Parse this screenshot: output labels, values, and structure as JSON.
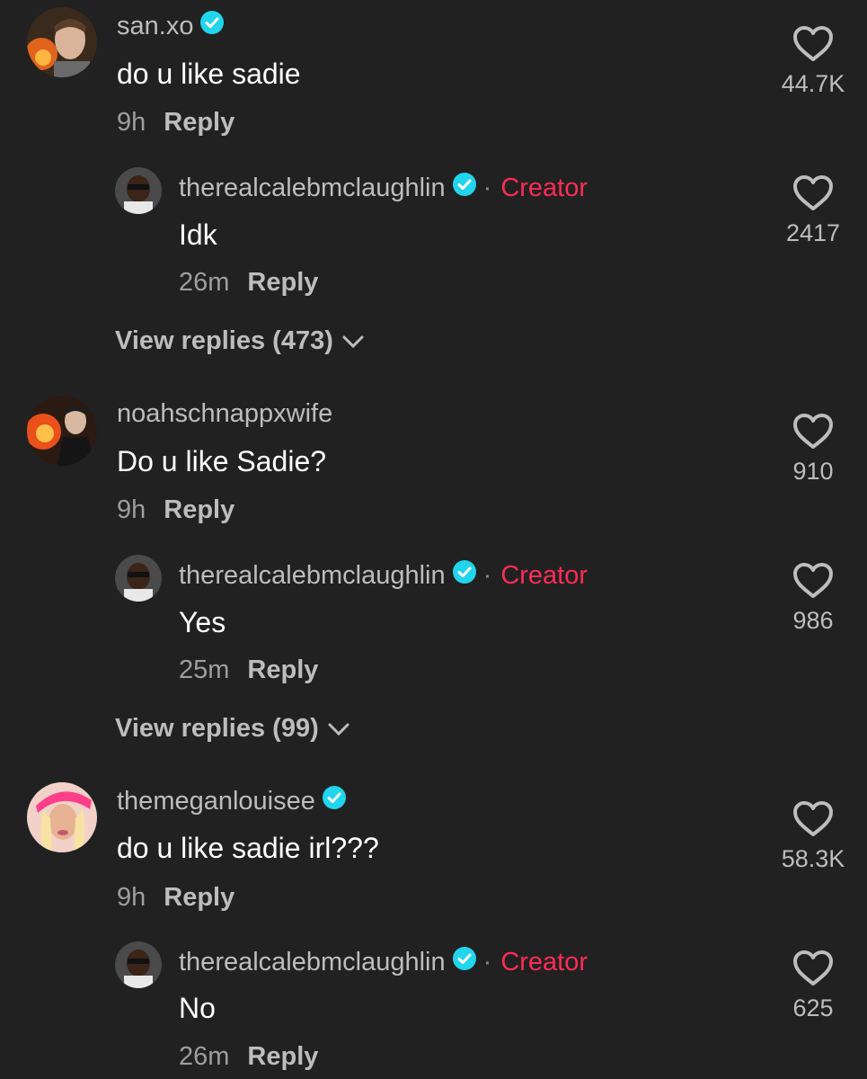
{
  "reply_label": "Reply",
  "threads": [
    {
      "comment": {
        "username": "san.xo",
        "verified": true,
        "text": "do u like sadie",
        "time": "9h",
        "likes": "44.7K"
      },
      "reply": {
        "username": "therealcalebmclaughlin",
        "verified": true,
        "badge": "Creator",
        "text": "Idk",
        "time": "26m",
        "likes": "2417"
      },
      "view_replies": "View replies (473)"
    },
    {
      "comment": {
        "username": "noahschnappxwife",
        "verified": false,
        "text": "Do u like Sadie?",
        "time": "9h",
        "likes": "910"
      },
      "reply": {
        "username": "therealcalebmclaughlin",
        "verified": true,
        "badge": "Creator",
        "text": "Yes",
        "time": "25m",
        "likes": "986"
      },
      "view_replies": "View replies (99)"
    },
    {
      "comment": {
        "username": "themeganlouisee",
        "verified": true,
        "text": "do u like sadie irl???",
        "time": "9h",
        "likes": "58.3K"
      },
      "reply": {
        "username": "therealcalebmclaughlin",
        "verified": true,
        "badge": "Creator",
        "text": "No",
        "time": "26m",
        "likes": "625"
      }
    }
  ],
  "colors": {
    "background": "#212121",
    "creator": "#fe2c55",
    "verified": "#20d5ec"
  }
}
